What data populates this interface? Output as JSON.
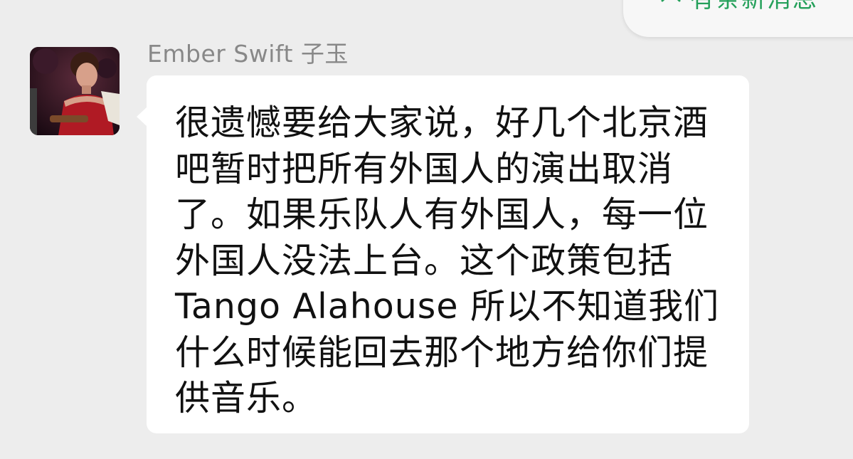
{
  "top_banner": {
    "icon": "chevron-up-icon",
    "text": "有条新消息",
    "text_color": "#24a05a"
  },
  "message": {
    "sender_name": "Ember Swift 子玉",
    "avatar": "performer-photo",
    "text": "很遗憾要给大家说，好几个北京酒\n吧暂时把所有外国人的演出取消\n了。如果乐队人有外国人，每一位\n外国人没法上台。这个政策包括\nTango Alahouse 所以不知道我们\n什么时候能回去那个地方给你们提\n供音乐。"
  },
  "colors": {
    "background": "#ededed",
    "bubble": "#ffffff",
    "sender_name": "#888888"
  }
}
